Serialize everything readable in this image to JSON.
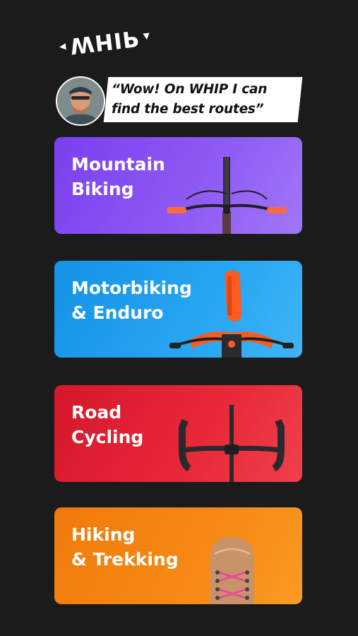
{
  "logo": {
    "text": "WHIP"
  },
  "testimonial": {
    "quote": "“Wow! On WHIP I can\nfind the best routes”"
  },
  "categories": [
    {
      "label": "Mountain\nBiking",
      "color": "#8a52f3",
      "icon": "mtb-handlebar-icon"
    },
    {
      "label": "Motorbiking\n& Enduro",
      "color": "#1e9cec",
      "icon": "motorbike-front-icon"
    },
    {
      "label": "Road\nCycling",
      "color": "#e2222f",
      "icon": "road-handlebar-icon"
    },
    {
      "label": "Hiking\n& Trekking",
      "color": "#f5840f",
      "icon": "hiking-boot-icon"
    }
  ]
}
